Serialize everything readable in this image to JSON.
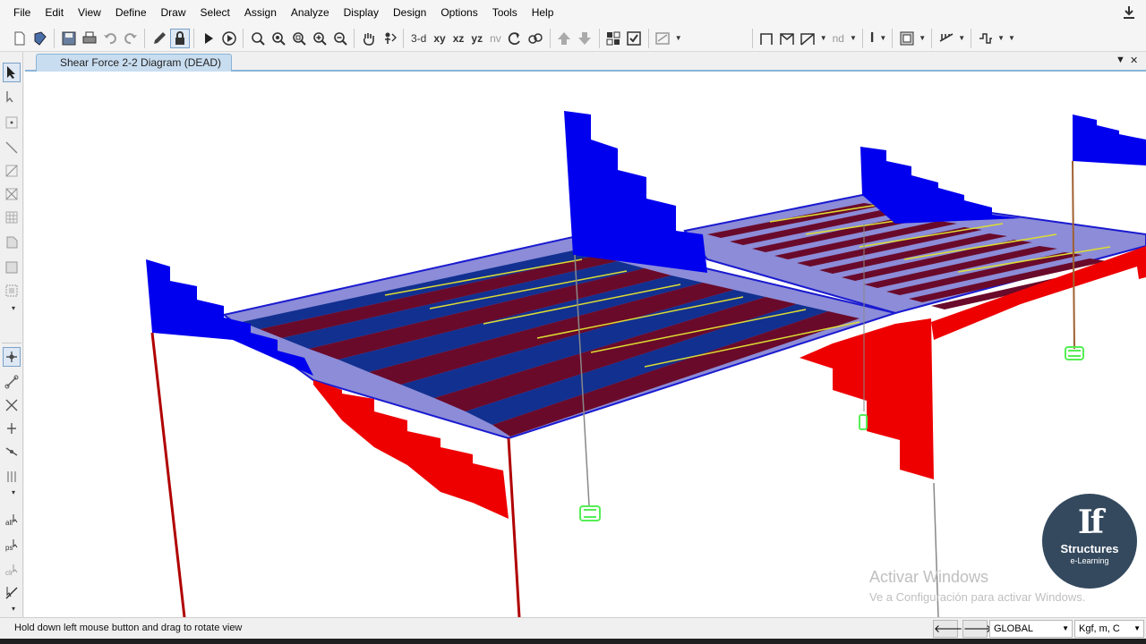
{
  "menu": {
    "items": [
      "File",
      "Edit",
      "View",
      "Define",
      "Draw",
      "Select",
      "Assign",
      "Analyze",
      "Display",
      "Design",
      "Options",
      "Tools",
      "Help"
    ]
  },
  "toolbar": {
    "view_3d": "3-d",
    "view_xy": "xy",
    "view_xz": "xz",
    "view_yz": "yz",
    "view_nv": "nv",
    "nd_label": "nd",
    "i_label": "I"
  },
  "tab": {
    "title": "Shear Force 2-2 Diagram (DEAD)",
    "dropdown_glyph": "▼",
    "close_glyph": "✕"
  },
  "watermark": {
    "title": "Activar Windows",
    "subtitle": "Ve a Configuración para activar Windows."
  },
  "logo": {
    "mark": "If",
    "name": "Structures",
    "tagline": "e-Learning"
  },
  "status": {
    "hint": "Hold down left mouse button and drag to rotate view",
    "prev_glyph": "🡐",
    "next_glyph": "🡒",
    "coord_system": "GLOBAL",
    "units": "Kgf, m, C"
  },
  "colors": {
    "positive_shear": "#0000ee",
    "negative_shear": "#ee0000",
    "slab": "#8c8cd8",
    "beam_red": "#b00000",
    "support": "#55ee55",
    "tab_bg": "#c9ddf0"
  }
}
